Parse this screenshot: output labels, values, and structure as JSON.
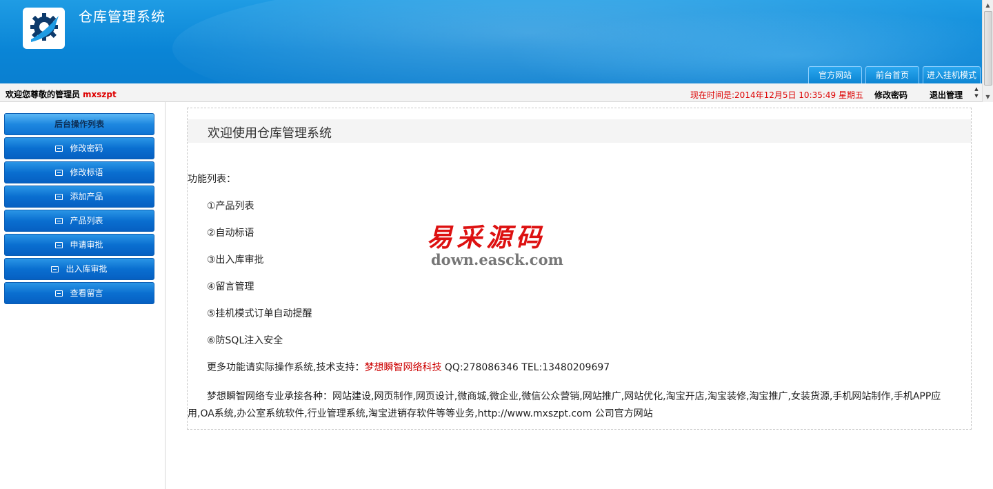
{
  "header": {
    "title": "仓库管理系统",
    "links": [
      "官方网站",
      "前台首页",
      "进入挂机模式"
    ]
  },
  "statusbar": {
    "welcome": "欢迎您尊敬的管理员",
    "username": "mxszpt",
    "time": "现在时间是:2014年12月5日 10:35:49 星期五",
    "change_password": "修改密码",
    "logout": "退出管理"
  },
  "sidebar": {
    "heading": "后台操作列表",
    "items": [
      "修改密码",
      "修改标语",
      "添加产品",
      "产品列表",
      "申请审批",
      "出入库审批",
      "查看留言"
    ]
  },
  "main": {
    "title": "欢迎使用仓库管理系统",
    "features_label": "功能列表：",
    "features": [
      "①产品列表",
      "②自动标语",
      "③出入库审批",
      "④留言管理",
      "⑤挂机模式订单自动提醒",
      "⑥防SQL注入安全"
    ],
    "more_prefix": "更多功能请实际操作系统,技术支持：",
    "company": "梦想瞬智网络科技",
    "contact": " QQ:278086346 TEL:13480209697",
    "paragraph": "梦想瞬智网络专业承接各种：网站建设,网页制作,网页设计,微商城,微企业,微信公众营销,网站推广,网站优化,淘宝开店,淘宝装修,淘宝推广,女装货源,手机网站制作,手机APP应用,OA系统,办公室系统软件,行业管理系统,淘宝进销存软件等等业务,http://www.mxszpt.com 公司官方网站"
  },
  "watermark": {
    "cn": "易采源码",
    "en": "down.easck.com"
  },
  "colors": {
    "header_blue": "#0a85d6",
    "accent_red": "#d00000",
    "menu_blue": "#0a6fd0"
  }
}
